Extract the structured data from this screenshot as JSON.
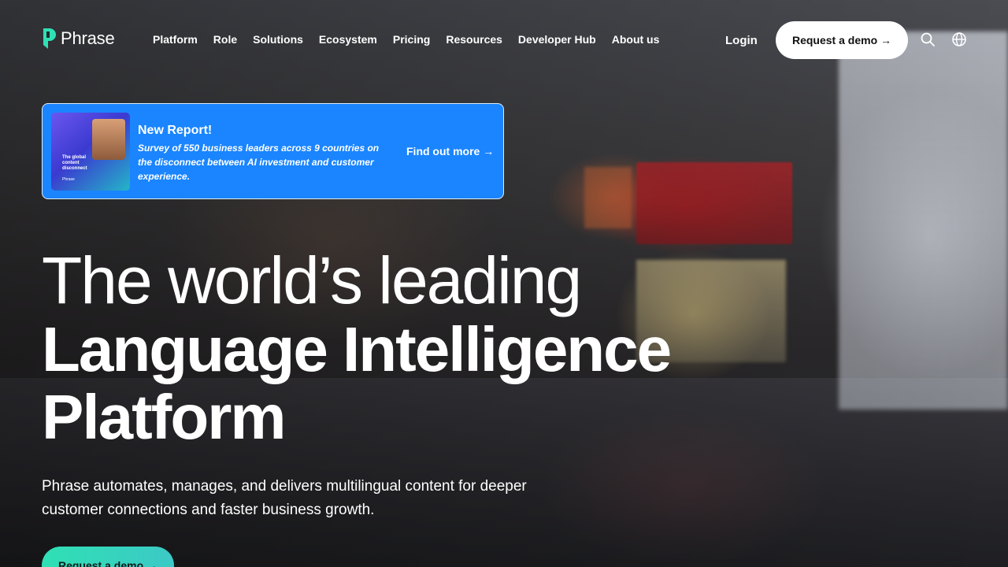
{
  "brand": {
    "name": "Phrase",
    "accent": "#2fe0b4"
  },
  "nav": {
    "items": [
      "Platform",
      "Role",
      "Solutions",
      "Ecosystem",
      "Pricing",
      "Resources",
      "Developer Hub",
      "About us"
    ],
    "login": "Login",
    "demo": "Request a demo →",
    "icons": [
      "search-icon",
      "globe-icon"
    ]
  },
  "report": {
    "title": "New Report!",
    "description": "Survey of 550 business leaders across 9 countries on the disconnect between AI investment and customer experience.",
    "link": "Find out more →",
    "thumbnail_title": "The global content disconnect",
    "thumbnail_brand": "Phrase",
    "background": "#1a85ff"
  },
  "hero": {
    "line1": "The world’s leading",
    "line2": "Language Intelligence",
    "line3": "Platform",
    "subtitle": "Phrase automates, manages, and delivers multilingual content for deeper customer connections and faster business growth.",
    "cta": "Request a demo →"
  }
}
